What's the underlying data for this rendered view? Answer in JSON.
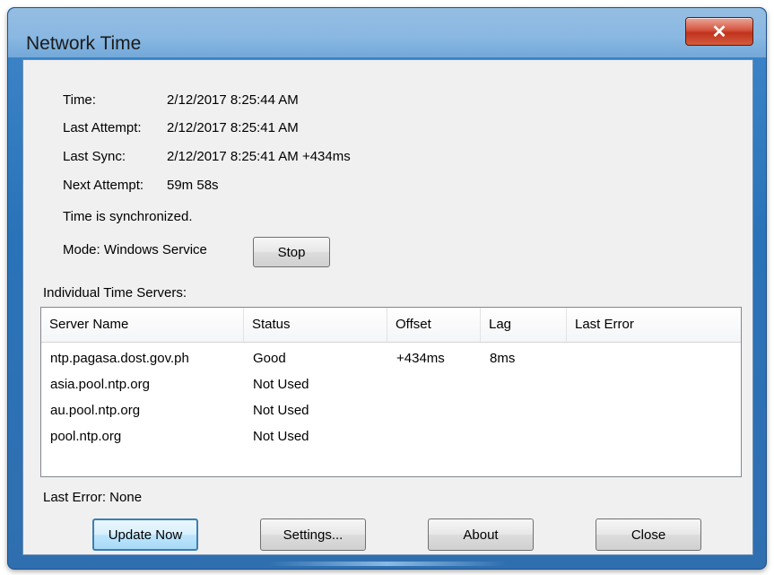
{
  "window": {
    "title": "Network Time",
    "close_glyph": "✕"
  },
  "info": {
    "time_label": "Time:",
    "time_value": "2/12/2017 8:25:44 AM",
    "last_attempt_label": "Last Attempt:",
    "last_attempt_value": "2/12/2017 8:25:41 AM",
    "last_sync_label": "Last Sync:",
    "last_sync_value": "2/12/2017 8:25:41 AM +434ms",
    "next_attempt_label": "Next Attempt:",
    "next_attempt_value": "59m 58s",
    "sync_status": "Time is synchronized.",
    "mode_text": "Mode: Windows Service",
    "stop_label": "Stop"
  },
  "servers": {
    "section_label": "Individual Time Servers:",
    "columns": [
      "Server Name",
      "Status",
      "Offset",
      "Lag",
      "Last Error"
    ],
    "rows": [
      {
        "name": "ntp.pagasa.dost.gov.ph",
        "status": "Good",
        "offset": "+434ms",
        "lag": "8ms",
        "last_error": ""
      },
      {
        "name": "asia.pool.ntp.org",
        "status": "Not Used",
        "offset": "",
        "lag": "",
        "last_error": ""
      },
      {
        "name": "au.pool.ntp.org",
        "status": "Not Used",
        "offset": "",
        "lag": "",
        "last_error": ""
      },
      {
        "name": "pool.ntp.org",
        "status": "Not Used",
        "offset": "",
        "lag": "",
        "last_error": ""
      }
    ]
  },
  "footer": {
    "last_error_text": "Last Error:  None",
    "update_now_label": "Update Now",
    "settings_label": "Settings...",
    "about_label": "About",
    "close_label": "Close"
  },
  "colors": {
    "title_bar": "#2f78bd",
    "close_button": "#c7402a",
    "default_button_border": "#3c7fb1"
  }
}
